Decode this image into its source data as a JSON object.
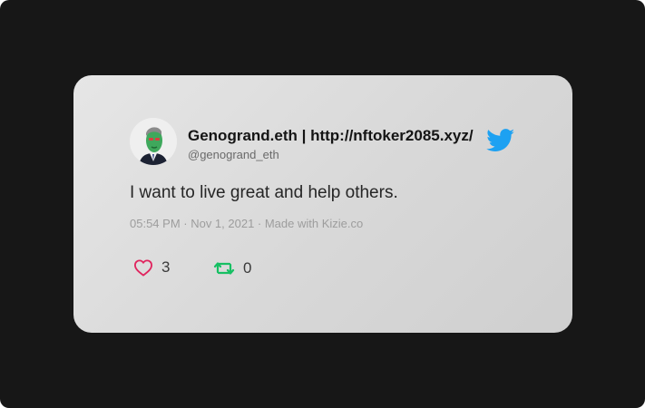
{
  "tweet": {
    "author_name": "Genogrand.eth | http://nftoker2085.xyz/",
    "author_handle": "@genogrand_eth",
    "text": "I want to live great and help others.",
    "meta": "05:54 PM · Nov 1, 2021 · Made with Kizie.co",
    "likes": "3",
    "retweets": "0"
  },
  "icons": {
    "like": "heart-icon",
    "retweet": "retweet-icon",
    "brand": "twitter-bird-icon"
  },
  "colors": {
    "background": "#171717",
    "card": "#e1e1e1",
    "like": "#e0245e",
    "retweet": "#17bf63",
    "twitter": "#1da1f2"
  }
}
